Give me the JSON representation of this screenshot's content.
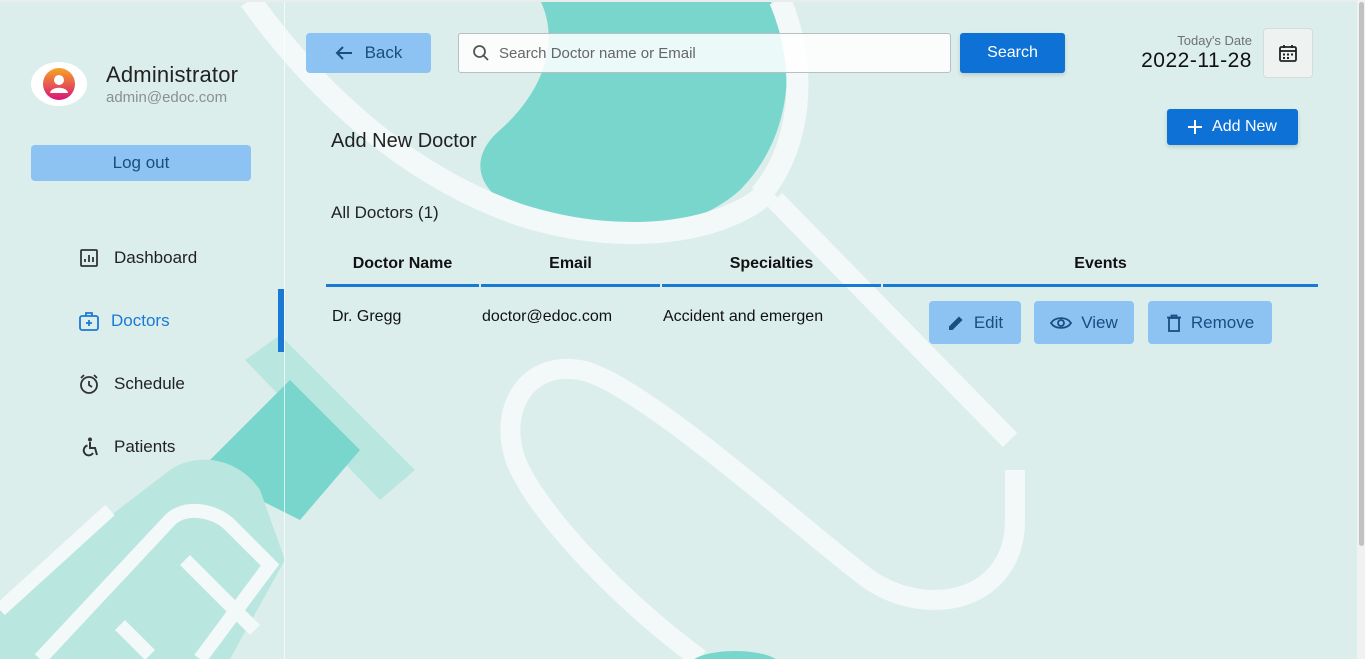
{
  "sidebar": {
    "profile": {
      "name": "Administrator",
      "email": "admin@edoc.com"
    },
    "logout_label": "Log out",
    "nav": [
      {
        "label": "Dashboard",
        "icon": "dashboard-icon"
      },
      {
        "label": "Doctors",
        "icon": "doctors-icon"
      },
      {
        "label": "Schedule",
        "icon": "clock-icon"
      },
      {
        "label": "Patients",
        "icon": "patients-icon"
      }
    ],
    "active_item": "Doctors"
  },
  "header": {
    "back_label": "Back",
    "search_placeholder": "Search Doctor name or Email",
    "search_button_label": "Search",
    "date_label": "Today's Date",
    "date_value": "2022-11-28"
  },
  "main": {
    "add_new_label": "Add New",
    "page_heading": "Add New Doctor",
    "subheading": "All Doctors (1)"
  },
  "table": {
    "columns": [
      "Doctor Name",
      "Email",
      "Specialties",
      "Events"
    ],
    "rows": [
      {
        "name": "Dr. Gregg",
        "email": "doctor@edoc.com",
        "specialty": "Accident and emergen",
        "actions": [
          "Edit",
          "View",
          "Remove"
        ]
      }
    ]
  },
  "colors": {
    "primary": "#0e71d6",
    "light_button": "#8cc3f3",
    "active_nav": "#1b79d6",
    "background": "#dbeeeb",
    "teal_accent": "#79d6cc"
  }
}
